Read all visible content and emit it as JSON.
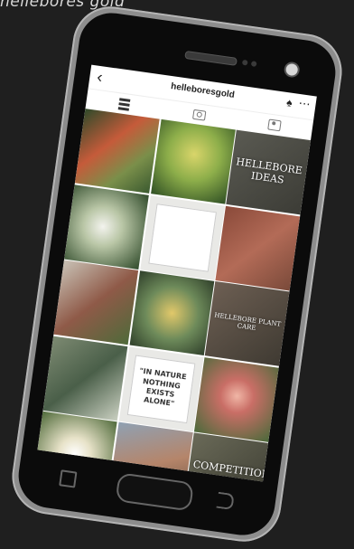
{
  "caption": "hellebores gold",
  "app": {
    "username": "helleboresgold",
    "back_icon": "back-arrow-icon",
    "bell_icon": "bell-icon",
    "more_icon": "more-icon",
    "tabs": [
      {
        "icon": "grid-icon"
      },
      {
        "icon": "camera-icon"
      },
      {
        "icon": "tagged-icon"
      }
    ]
  },
  "tiles": [
    {
      "kind": "photo",
      "bg": "linear-gradient(135deg,#2f4a2a,#c55b3a 40%,#7a8f4a 70%,#3b5a30)"
    },
    {
      "kind": "photo",
      "bg": "radial-gradient(circle at 50% 40%,#d9d56a,#8dae4a 45%,#2f4f24)"
    },
    {
      "kind": "text",
      "bg": "linear-gradient(135deg,#5a5a52,#3c3c36)",
      "text": "HELLEBORE IDEAS",
      "small": false
    },
    {
      "kind": "photo",
      "bg": "radial-gradient(circle at 45% 50%,#f3f3ee,#b9c6a6 35%,#2f4a2a)"
    },
    {
      "kind": "quote",
      "bg": "#e9e9e6",
      "text": "",
      "big": false
    },
    {
      "kind": "photo",
      "bg": "linear-gradient(135deg,#8a4a3a,#b36b57 50%,#7a4a3a)"
    },
    {
      "kind": "photo",
      "bg": "linear-gradient(135deg,#c9c2b6,#8f5a48 50%,#4f6a3a)"
    },
    {
      "kind": "photo",
      "bg": "radial-gradient(circle at 50% 50%,#e1c86a,#6d8a5a 50%,#2f3f2a)"
    },
    {
      "kind": "text",
      "bg": "linear-gradient(135deg,#6d5f53,#3f3a32)",
      "text": "HELLEBORE PLANT CARE",
      "small": true
    },
    {
      "kind": "photo",
      "bg": "linear-gradient(135deg,#7d8a72,#4a5f49 50%,#c9cfc0)"
    },
    {
      "kind": "quote",
      "bg": "#e9e9e6",
      "text": "\"IN NATURE NOTHING EXISTS ALONE\"",
      "big": true
    },
    {
      "kind": "photo",
      "bg": "radial-gradient(circle at 50% 45%,#f0b6a6,#c96e66 30%,#4a6a3a)"
    },
    {
      "kind": "photo",
      "bg": "radial-gradient(circle at 50% 50%,#ffffff,#e7e2c8 30%,#4f6a3a)"
    },
    {
      "kind": "photo",
      "bg": "linear-gradient(160deg,#8fa1b3,#b5856a 50%,#5f4a3a)"
    },
    {
      "kind": "text",
      "bg": "linear-gradient(135deg,#6a6a58,#3a3a30)",
      "text": "COMPETITION WINNER",
      "small": false
    }
  ],
  "nav": {
    "back_icon": "back-square-icon",
    "home_icon": "home-button",
    "recent_icon": "recent-apps-icon"
  }
}
